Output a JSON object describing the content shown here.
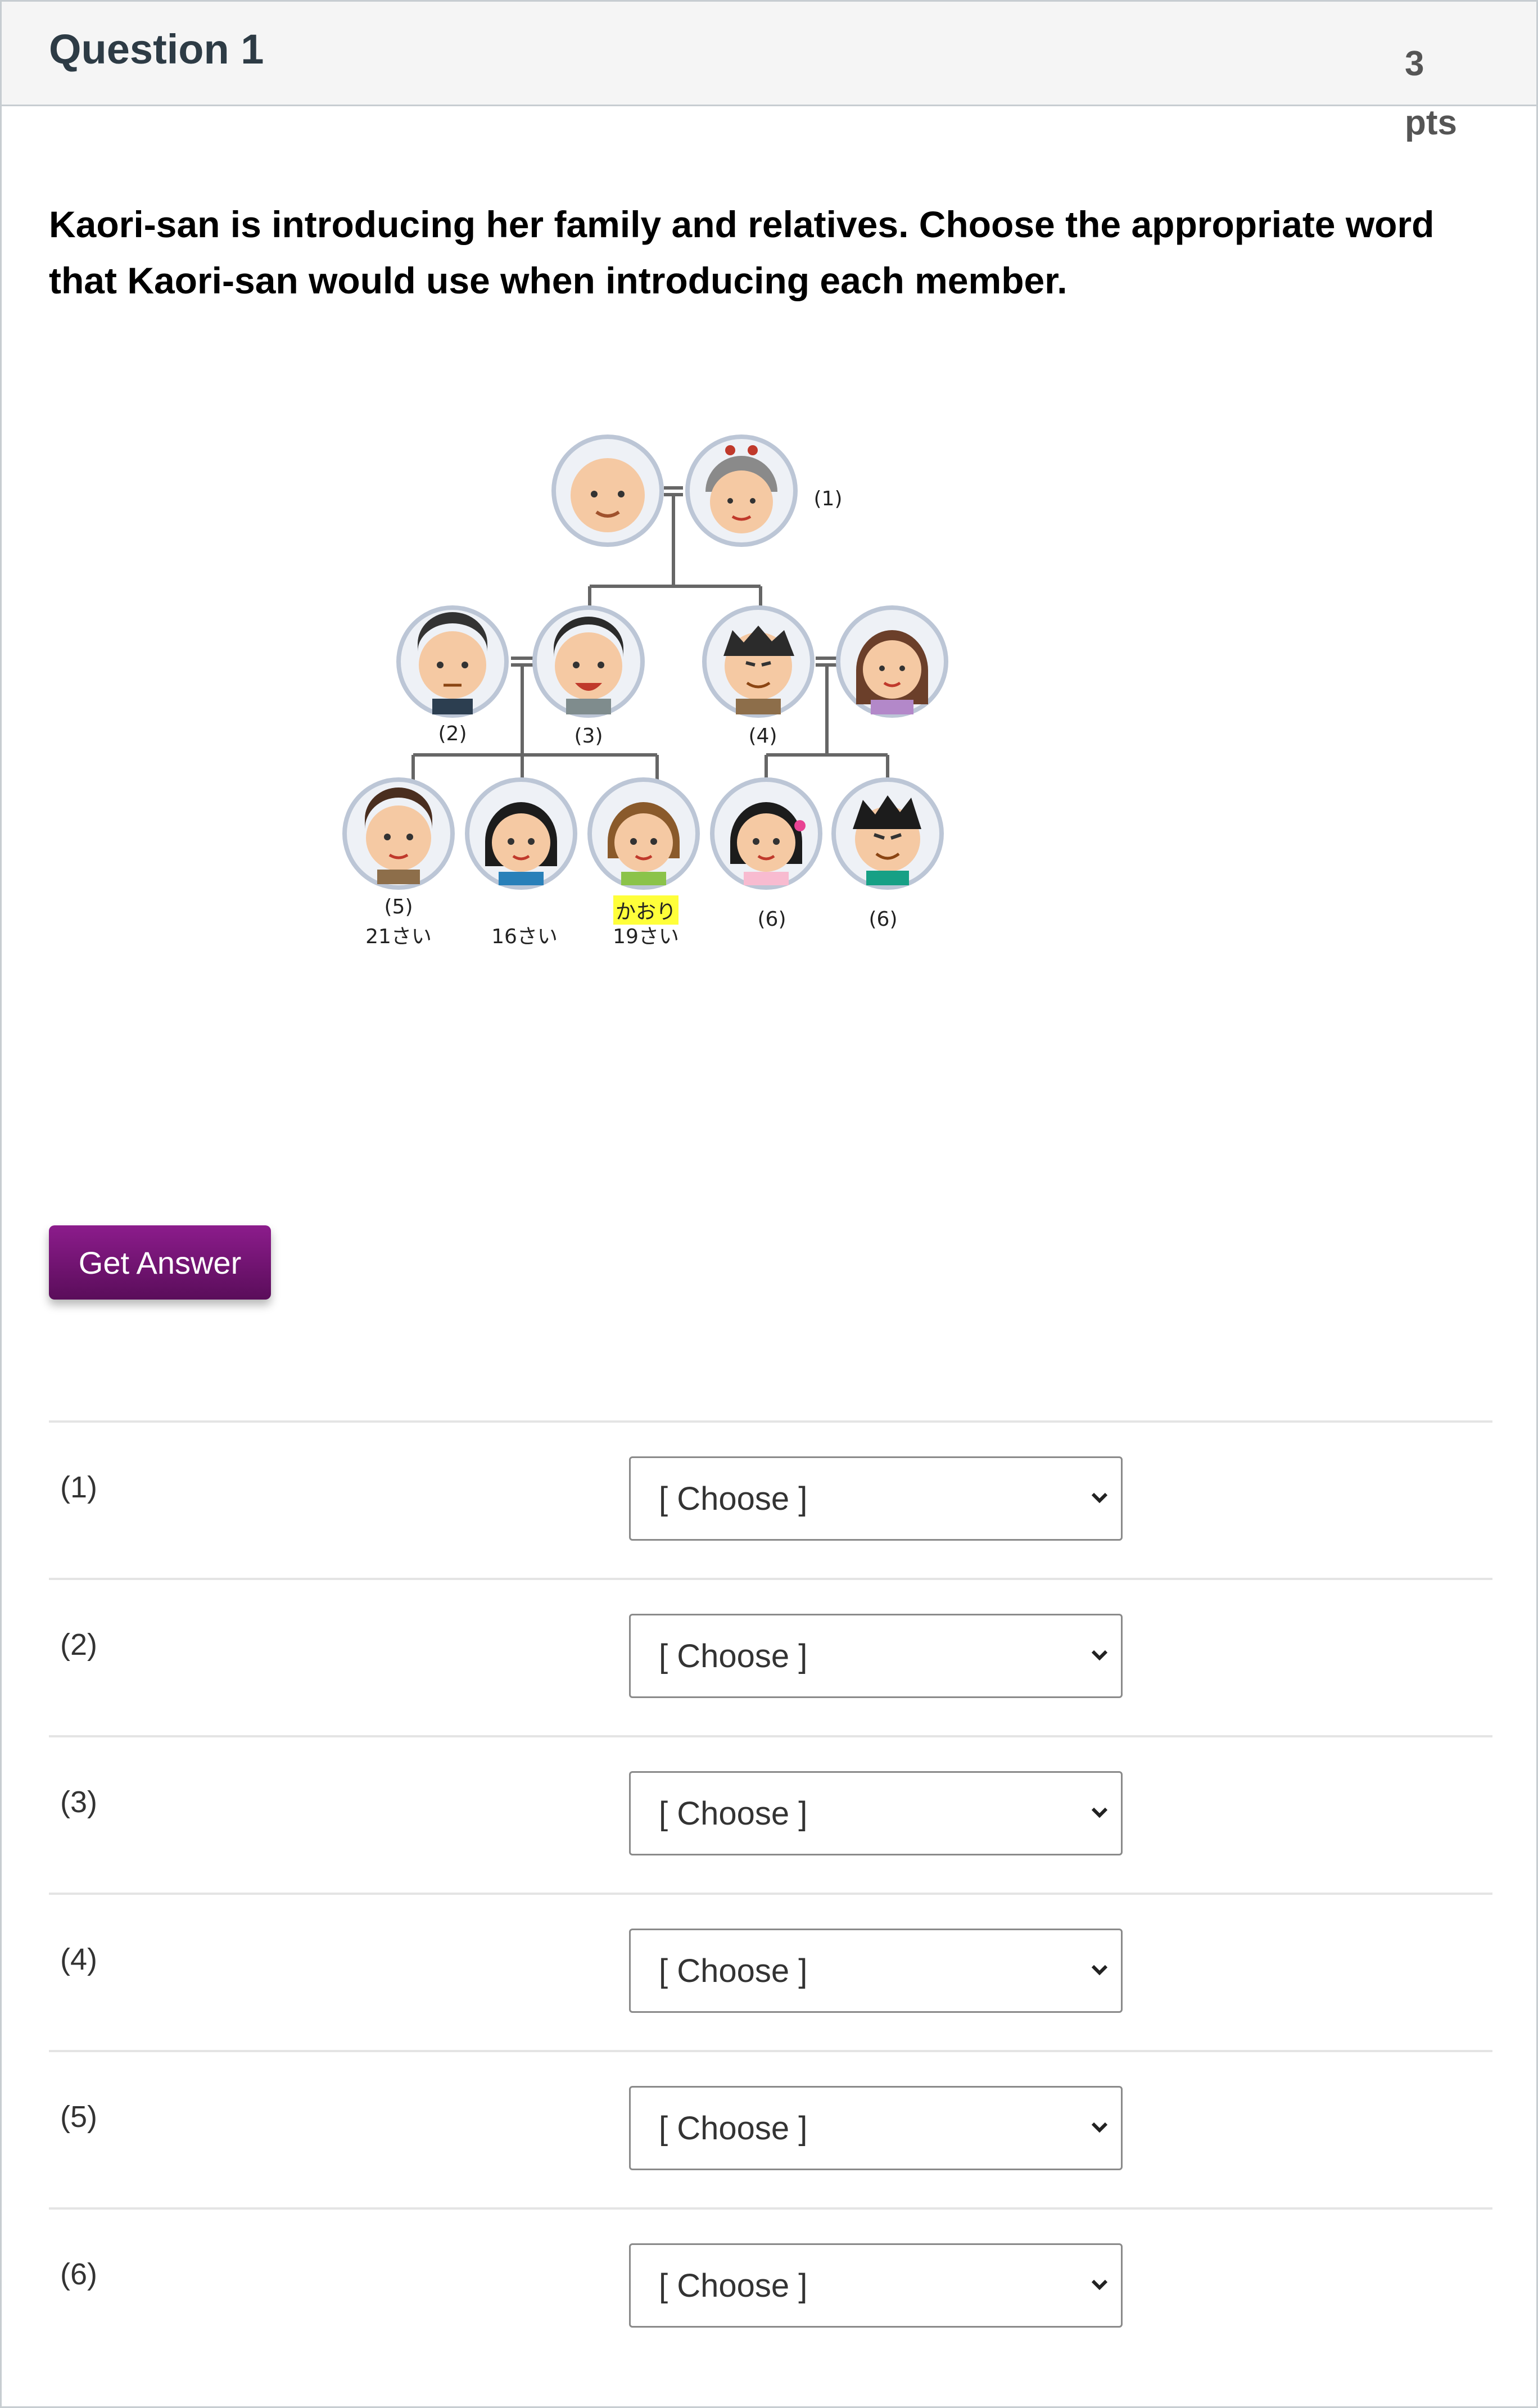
{
  "header": {
    "title": "Question 1",
    "points": "3 pts"
  },
  "prompt": "Kaori-san is introducing her family and relatives. Choose the appropriate word that Kaori-san would use when introducing each member.",
  "tree": {
    "labels": {
      "n1": "(1)",
      "n2": "(2)",
      "n3": "(3)",
      "n4": "(4)",
      "n5": "(5)",
      "age5": "21さい",
      "age16": "16さい",
      "kaori": "かおり",
      "age19": "19さい",
      "n6a": "(6)",
      "n6b": "(6)"
    }
  },
  "button": {
    "label": "Get Answer"
  },
  "rows": [
    {
      "label": "(1)",
      "selected": "[ Choose ]"
    },
    {
      "label": "(2)",
      "selected": "[ Choose ]"
    },
    {
      "label": "(3)",
      "selected": "[ Choose ]"
    },
    {
      "label": "(4)",
      "selected": "[ Choose ]"
    },
    {
      "label": "(5)",
      "selected": "[ Choose ]"
    },
    {
      "label": "(6)",
      "selected": "[ Choose ]"
    }
  ],
  "icons": {
    "select_arrow": "chevron-down-icon"
  }
}
